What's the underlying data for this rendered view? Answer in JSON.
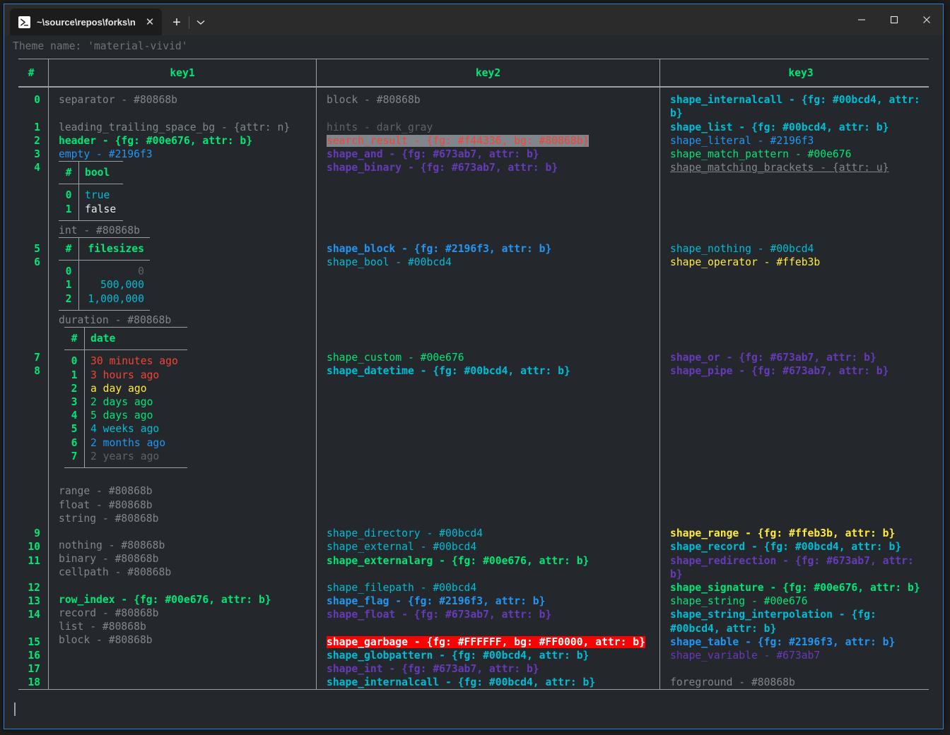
{
  "window": {
    "tab": {
      "icon": "powershell-icon",
      "title": "~\\source\\repos\\forks\\nu_scrip",
      "close": "✕"
    },
    "new_tab": "+",
    "dropdown": "⌄",
    "controls": {
      "minimize": "—",
      "maximize": "□",
      "close": "✕"
    },
    "accent_border": "#2f7fd1"
  },
  "terminal": {
    "theme_line": "Theme name: 'material-vivid'",
    "cursor": true
  },
  "table": {
    "headers": [
      "#",
      "key1",
      "key2",
      "key3"
    ],
    "index_groups": [
      [
        "0"
      ],
      [
        "1",
        "2",
        "3",
        "4"
      ],
      [
        "5",
        "6"
      ],
      [
        "7",
        "8"
      ],
      [
        "9",
        "10",
        "11"
      ],
      [
        "12",
        "13",
        "14"
      ],
      [
        "15",
        "16",
        "17",
        "18"
      ]
    ],
    "indices": [
      "0",
      "1",
      "2",
      "3",
      "4",
      "5",
      "6",
      "7",
      "8",
      "9",
      "10",
      "11",
      "12",
      "13",
      "14",
      "15",
      "16",
      "17",
      "18"
    ]
  },
  "key1": {
    "rows": [
      {
        "text": "separator - #80868b",
        "style": "g"
      },
      {
        "text": "",
        "style": "blank"
      },
      {
        "text": "leading_trailing_space_bg - {attr: n}",
        "style": "g"
      },
      {
        "text": "header - {fg: #00e676, attr: b}",
        "style": "green"
      },
      {
        "text": "empty - #2196f3",
        "style": "blue"
      }
    ],
    "bool_table": {
      "headers": [
        "#",
        "bool"
      ],
      "rows": [
        {
          "idx": "0",
          "value": "true",
          "style": "cyan"
        },
        {
          "idx": "1",
          "value": "false",
          "style": "white"
        }
      ]
    },
    "int_row": {
      "text": "int - #80868b",
      "style": "g"
    },
    "filesizes_table": {
      "headers": [
        "#",
        "filesizes"
      ],
      "rows": [
        {
          "idx": "0",
          "value": "0",
          "style": "dark"
        },
        {
          "idx": "1",
          "value": "500,000",
          "style": "cyan"
        },
        {
          "idx": "2",
          "value": "1,000,000",
          "style": "cyan"
        }
      ]
    },
    "duration_row": {
      "text": "duration - #80868b",
      "style": "g"
    },
    "date_table": {
      "headers": [
        "#",
        "date"
      ],
      "rows": [
        {
          "idx": "0",
          "value": "30 minutes ago",
          "style": "red"
        },
        {
          "idx": "1",
          "value": "3 hours ago",
          "style": "red"
        },
        {
          "idx": "2",
          "value": "a day ago",
          "style": "yellow"
        },
        {
          "idx": "3",
          "value": "2 days ago",
          "style": "green-n"
        },
        {
          "idx": "4",
          "value": "5 days ago",
          "style": "green-n"
        },
        {
          "idx": "5",
          "value": "4 weeks ago",
          "style": "cyan"
        },
        {
          "idx": "6",
          "value": "2 months ago",
          "style": "blue"
        },
        {
          "idx": "7",
          "value": "2 years ago",
          "style": "dark"
        }
      ]
    },
    "tail_rows": [
      {
        "text": "range - #80868b",
        "style": "g"
      },
      {
        "text": "float - #80868b",
        "style": "g"
      },
      {
        "text": "string - #80868b",
        "style": "g"
      },
      {
        "text": "",
        "style": "blank"
      },
      {
        "text": "nothing - #80868b",
        "style": "g"
      },
      {
        "text": "binary - #80868b",
        "style": "g"
      },
      {
        "text": "cellpath - #80868b",
        "style": "g"
      },
      {
        "text": "",
        "style": "blank"
      },
      {
        "text": "row_index - {fg: #00e676, attr: b}",
        "style": "green"
      },
      {
        "text": "record - #80868b",
        "style": "g"
      },
      {
        "text": "list - #80868b",
        "style": "g"
      },
      {
        "text": "block - #80868b",
        "style": "g"
      }
    ]
  },
  "key2": {
    "rows": [
      {
        "text": "block - #80868b",
        "style": "g"
      },
      {
        "text": "",
        "style": "blank"
      },
      {
        "text": "hints - dark_gray",
        "style": "dark"
      },
      {
        "text": "search_result - {fg: #f44336, bg: #80868b}",
        "style": "hl-search"
      },
      {
        "text": "shape_and - {fg: #673ab7, attr: b}",
        "style": "purple"
      },
      {
        "text": "shape_binary - {fg: #673ab7, attr: b}",
        "style": "purple"
      },
      {
        "text": "",
        "style": "blank"
      },
      {
        "text": "",
        "style": "blank"
      },
      {
        "text": "",
        "style": "blank"
      },
      {
        "text": "",
        "style": "blank"
      },
      {
        "text": "",
        "style": "blank"
      },
      {
        "text": "shape_block - {fg: #2196f3, attr: b}",
        "style": "blue-b"
      },
      {
        "text": "shape_bool - #00bcd4",
        "style": "cyan"
      },
      {
        "text": "",
        "style": "blank"
      },
      {
        "text": "",
        "style": "blank"
      },
      {
        "text": "",
        "style": "blank"
      },
      {
        "text": "",
        "style": "blank"
      },
      {
        "text": "",
        "style": "blank"
      },
      {
        "text": "",
        "style": "blank"
      },
      {
        "text": "shape_custom - #00e676",
        "style": "green-n"
      },
      {
        "text": "shape_datetime - {fg: #00bcd4, attr: b}",
        "style": "cyan-b"
      },
      {
        "text": "",
        "style": "blank"
      },
      {
        "text": "",
        "style": "blank"
      },
      {
        "text": "",
        "style": "blank"
      },
      {
        "text": "",
        "style": "blank"
      },
      {
        "text": "",
        "style": "blank"
      },
      {
        "text": "",
        "style": "blank"
      },
      {
        "text": "",
        "style": "blank"
      },
      {
        "text": "",
        "style": "blank"
      },
      {
        "text": "",
        "style": "blank"
      },
      {
        "text": "",
        "style": "blank"
      },
      {
        "text": "",
        "style": "blank"
      },
      {
        "text": "shape_directory - #00bcd4",
        "style": "cyan"
      },
      {
        "text": "shape_external - #00bcd4",
        "style": "cyan"
      },
      {
        "text": "shape_externalarg - {fg: #00e676, attr: b}",
        "style": "green"
      },
      {
        "text": "",
        "style": "blank"
      },
      {
        "text": "shape_filepath - #00bcd4",
        "style": "cyan"
      },
      {
        "text": "shape_flag - {fg: #2196f3, attr: b}",
        "style": "blue-b"
      },
      {
        "text": "shape_float - {fg: #673ab7, attr: b}",
        "style": "purple"
      },
      {
        "text": "",
        "style": "blank"
      },
      {
        "text": "shape_garbage - {fg: #FFFFFF, bg: #FF0000, attr: b}",
        "style": "hl-garbage"
      },
      {
        "text": "shape_globpattern - {fg: #00bcd4, attr: b}",
        "style": "cyan-b"
      },
      {
        "text": "shape_int - {fg: #673ab7, attr: b}",
        "style": "purple"
      },
      {
        "text": "shape_internalcall - {fg: #00bcd4, attr: b}",
        "style": "cyan-b"
      }
    ]
  },
  "key3": {
    "rows": [
      {
        "text": "shape_internalcall - {fg: #00bcd4, attr:",
        "style": "cyan-b"
      },
      {
        "text": "b}",
        "style": "cyan-b"
      },
      {
        "text": "shape_list - {fg: #00bcd4, attr: b}",
        "style": "cyan-b"
      },
      {
        "text": "shape_literal - #2196f3",
        "style": "blue"
      },
      {
        "text": "shape_match_pattern - #00e676",
        "style": "green-n"
      },
      {
        "text": "shape_matching_brackets - {attr: u}",
        "style": "ul"
      },
      {
        "text": "",
        "style": "blank"
      },
      {
        "text": "",
        "style": "blank"
      },
      {
        "text": "",
        "style": "blank"
      },
      {
        "text": "",
        "style": "blank"
      },
      {
        "text": "",
        "style": "blank"
      },
      {
        "text": "shape_nothing - #00bcd4",
        "style": "cyan"
      },
      {
        "text": "shape_operator - #ffeb3b",
        "style": "yellow"
      },
      {
        "text": "",
        "style": "blank"
      },
      {
        "text": "",
        "style": "blank"
      },
      {
        "text": "",
        "style": "blank"
      },
      {
        "text": "",
        "style": "blank"
      },
      {
        "text": "",
        "style": "blank"
      },
      {
        "text": "",
        "style": "blank"
      },
      {
        "text": "shape_or - {fg: #673ab7, attr: b}",
        "style": "purple"
      },
      {
        "text": "shape_pipe - {fg: #673ab7, attr: b}",
        "style": "purple"
      },
      {
        "text": "",
        "style": "blank"
      },
      {
        "text": "",
        "style": "blank"
      },
      {
        "text": "",
        "style": "blank"
      },
      {
        "text": "",
        "style": "blank"
      },
      {
        "text": "",
        "style": "blank"
      },
      {
        "text": "",
        "style": "blank"
      },
      {
        "text": "",
        "style": "blank"
      },
      {
        "text": "",
        "style": "blank"
      },
      {
        "text": "",
        "style": "blank"
      },
      {
        "text": "",
        "style": "blank"
      },
      {
        "text": "",
        "style": "blank"
      },
      {
        "text": "shape_range - {fg: #ffeb3b, attr: b}",
        "style": "yellow-b"
      },
      {
        "text": "shape_record - {fg: #00bcd4, attr: b}",
        "style": "cyan-b"
      },
      {
        "text": "shape_redirection - {fg: #673ab7, attr:",
        "style": "purple"
      },
      {
        "text": "b}",
        "style": "purple"
      },
      {
        "text": "shape_signature - {fg: #00e676, attr: b}",
        "style": "green"
      },
      {
        "text": "shape_string - #00e676",
        "style": "green-n"
      },
      {
        "text": "shape_string_interpolation - {fg:",
        "style": "cyan-b"
      },
      {
        "text": "#00bcd4, attr: b}",
        "style": "cyan-b"
      },
      {
        "text": "shape_table - {fg: #2196f3, attr: b}",
        "style": "blue-b"
      },
      {
        "text": "shape_variable - #673ab7",
        "style": "purple-n"
      },
      {
        "text": "",
        "style": "blank"
      },
      {
        "text": "foreground - #80868b",
        "style": "g"
      }
    ]
  },
  "colors": {
    "grey": "#80868b",
    "green": "#00e676",
    "blue": "#2196f3",
    "cyan": "#00bcd4",
    "purple": "#673ab7",
    "yellow": "#ffeb3b",
    "red": "#f44336",
    "garbage_bg": "#FF0000",
    "garbage_fg": "#FFFFFF",
    "background": "#24282c",
    "border": "#9aa0a6",
    "accent": "#2f7fd1"
  }
}
